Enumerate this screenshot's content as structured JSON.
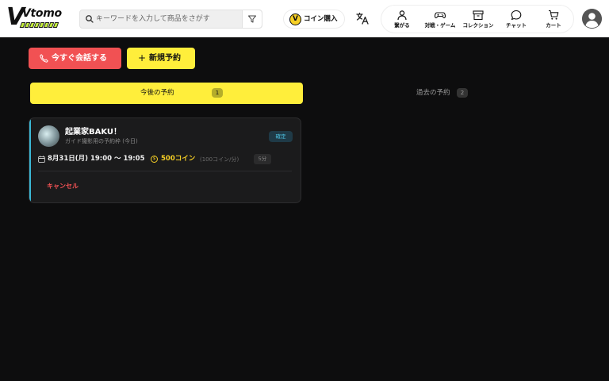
{
  "header": {
    "logo_text": "Vtomo",
    "search_placeholder": "キーワードを入力して商品をさがす",
    "coin_button": "コイン購入",
    "nav": [
      {
        "label": "繋がる",
        "icon": "person-icon"
      },
      {
        "label": "対戦・ゲーム",
        "icon": "gamepad-icon"
      },
      {
        "label": "コレクション",
        "icon": "archive-box-icon"
      },
      {
        "label": "チャット",
        "icon": "chat-bubble-icon"
      },
      {
        "label": "カート",
        "icon": "cart-icon"
      }
    ]
  },
  "actions": {
    "call_now": "今すぐ会話する",
    "new_reservation": "新規予約"
  },
  "tabs": {
    "upcoming": {
      "label": "今後の予約",
      "count": "1"
    },
    "past": {
      "label": "過去の予約",
      "count": "2"
    }
  },
  "reservation": {
    "name": "起業家BAKU！",
    "subtitle": "ガイド撮影用の予約枠 (今日)",
    "status": "確定",
    "datetime": "8月31日(月) 19:00 〜 19:05",
    "price": "500コイン",
    "rate": "(100コイン/分)",
    "duration": "5分",
    "cancel": "キャンセル"
  },
  "colors": {
    "accent_yellow": "#ffee3b",
    "accent_red": "#f15153",
    "accent_cyan": "#3bb8d6",
    "coin_gold": "#f6cf25"
  }
}
